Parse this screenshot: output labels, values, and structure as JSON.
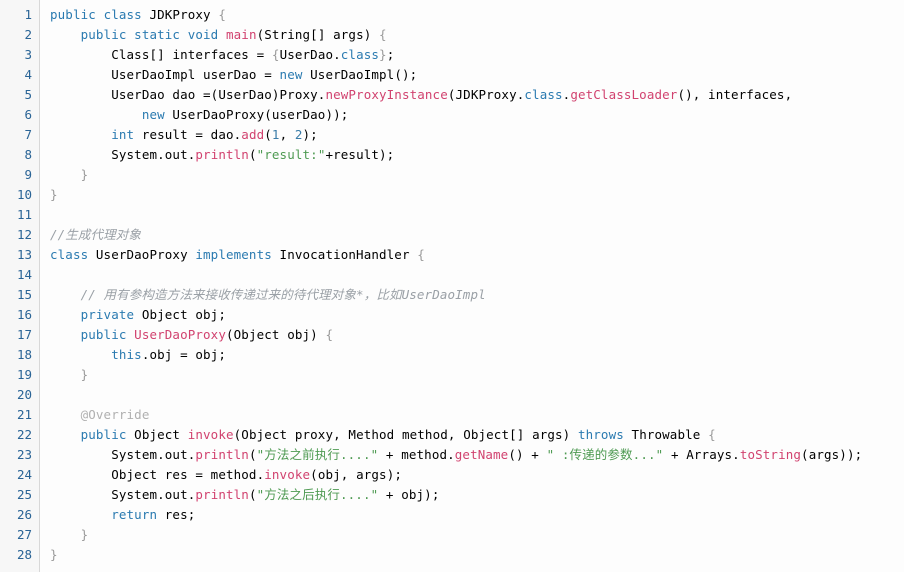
{
  "editor": {
    "language": "java",
    "first_line": 1,
    "total_lines": 28,
    "colors": {
      "background": "#fdfdfd",
      "gutter_background": "#f7f7f7",
      "gutter_border": "#d8d8d8",
      "line_number": "#2a6496",
      "keyword": "#2a7ab0",
      "identifier": "#000000",
      "method": "#d1426f",
      "string": "#4e9a52",
      "number": "#3a7ca8",
      "comment": "#9aa0a6",
      "annotation": "#b0b0b0",
      "brace": "#9a9a9a"
    }
  },
  "line_numbers": [
    "1",
    "2",
    "3",
    "4",
    "5",
    "6",
    "7",
    "8",
    "9",
    "10",
    "11",
    "12",
    "13",
    "14",
    "15",
    "16",
    "17",
    "18",
    "19",
    "20",
    "21",
    "22",
    "23",
    "24",
    "25",
    "26",
    "27",
    "28"
  ],
  "code_lines": [
    {
      "n": 1,
      "text": "public class JDKProxy {"
    },
    {
      "n": 2,
      "text": "    public static void main(String[] args) {"
    },
    {
      "n": 3,
      "text": "        Class[] interfaces = {UserDao.class};"
    },
    {
      "n": 4,
      "text": "        UserDaoImpl userDao = new UserDaoImpl();"
    },
    {
      "n": 5,
      "text": "        UserDao dao =(UserDao)Proxy.newProxyInstance(JDKProxy.class.getClassLoader(), interfaces,"
    },
    {
      "n": 6,
      "text": "            new UserDaoProxy(userDao));"
    },
    {
      "n": 7,
      "text": "        int result = dao.add(1, 2);"
    },
    {
      "n": 8,
      "text": "        System.out.println(\"result:\"+result);"
    },
    {
      "n": 9,
      "text": "    }"
    },
    {
      "n": 10,
      "text": "}"
    },
    {
      "n": 11,
      "text": ""
    },
    {
      "n": 12,
      "text": "//生成代理对象"
    },
    {
      "n": 13,
      "text": "class UserDaoProxy implements InvocationHandler {"
    },
    {
      "n": 14,
      "text": ""
    },
    {
      "n": 15,
      "text": "    // 用有参构造方法来接收传递过来的待代理对象*，比如UserDaoImpl"
    },
    {
      "n": 16,
      "text": "    private Object obj;"
    },
    {
      "n": 17,
      "text": "    public UserDaoProxy(Object obj) {"
    },
    {
      "n": 18,
      "text": "        this.obj = obj;"
    },
    {
      "n": 19,
      "text": "    }"
    },
    {
      "n": 20,
      "text": ""
    },
    {
      "n": 21,
      "text": "    @Override"
    },
    {
      "n": 22,
      "text": "    public Object invoke(Object proxy, Method method, Object[] args) throws Throwable {"
    },
    {
      "n": 23,
      "text": "        System.out.println(\"方法之前执行....\" + method.getName() + \" :传递的参数...\" + Arrays.toString(args));"
    },
    {
      "n": 24,
      "text": "        Object res = method.invoke(obj, args);"
    },
    {
      "n": 25,
      "text": "        System.out.println(\"方法之后执行....\" + obj);"
    },
    {
      "n": 26,
      "text": "        return res;"
    },
    {
      "n": 27,
      "text": "    }"
    },
    {
      "n": 28,
      "text": "}"
    }
  ],
  "tokens": {
    "l1": [
      [
        "public ",
        "t-kw"
      ],
      [
        "class ",
        "t-kw"
      ],
      [
        "JDKProxy ",
        "t-plain"
      ],
      [
        "{",
        "t-brc"
      ]
    ],
    "l2": [
      [
        "    ",
        "t-plain"
      ],
      [
        "public ",
        "t-kw"
      ],
      [
        "static ",
        "t-kw"
      ],
      [
        "void ",
        "t-kw"
      ],
      [
        "main",
        "t-meth"
      ],
      [
        "(",
        "t-punc"
      ],
      [
        "String",
        "t-plain"
      ],
      [
        "[] ",
        "t-punc"
      ],
      [
        "args",
        "t-plain"
      ],
      [
        ") ",
        "t-punc"
      ],
      [
        "{",
        "t-brc"
      ]
    ],
    "l3": [
      [
        "        ",
        "t-plain"
      ],
      [
        "Class",
        "t-plain"
      ],
      [
        "[] ",
        "t-punc"
      ],
      [
        "interfaces = ",
        "t-plain"
      ],
      [
        "{",
        "t-brc"
      ],
      [
        "UserDao",
        "t-plain"
      ],
      [
        ".",
        "t-punc"
      ],
      [
        "class",
        "t-kw"
      ],
      [
        "}",
        "t-brc"
      ],
      [
        ";",
        "t-punc"
      ]
    ],
    "l4": [
      [
        "        ",
        "t-plain"
      ],
      [
        "UserDaoImpl userDao = ",
        "t-plain"
      ],
      [
        "new ",
        "t-kw"
      ],
      [
        "UserDaoImpl",
        "t-plain"
      ],
      [
        "();",
        "t-punc"
      ]
    ],
    "l5": [
      [
        "        ",
        "t-plain"
      ],
      [
        "UserDao dao =(UserDao)Proxy",
        "t-plain"
      ],
      [
        ".",
        "t-punc"
      ],
      [
        "newProxyInstance",
        "t-meth"
      ],
      [
        "(",
        "t-punc"
      ],
      [
        "JDKProxy",
        "t-plain"
      ],
      [
        ".",
        "t-punc"
      ],
      [
        "class",
        "t-kw"
      ],
      [
        ".",
        "t-punc"
      ],
      [
        "getClassLoader",
        "t-meth"
      ],
      [
        "(), ",
        "t-punc"
      ],
      [
        "interfaces",
        "t-plain"
      ],
      [
        ",",
        "t-punc"
      ]
    ],
    "l6": [
      [
        "            ",
        "t-plain"
      ],
      [
        "new ",
        "t-kw"
      ],
      [
        "UserDaoProxy",
        "t-plain"
      ],
      [
        "(",
        "t-punc"
      ],
      [
        "userDao",
        "t-plain"
      ],
      [
        "));",
        "t-punc"
      ]
    ],
    "l7": [
      [
        "        ",
        "t-plain"
      ],
      [
        "int ",
        "t-kw"
      ],
      [
        "result = dao",
        "t-plain"
      ],
      [
        ".",
        "t-punc"
      ],
      [
        "add",
        "t-meth"
      ],
      [
        "(",
        "t-punc"
      ],
      [
        "1",
        "t-num"
      ],
      [
        ", ",
        "t-punc"
      ],
      [
        "2",
        "t-num"
      ],
      [
        ");",
        "t-punc"
      ]
    ],
    "l8": [
      [
        "        ",
        "t-plain"
      ],
      [
        "System",
        "t-plain"
      ],
      [
        ".",
        "t-punc"
      ],
      [
        "out",
        "t-plain"
      ],
      [
        ".",
        "t-punc"
      ],
      [
        "println",
        "t-meth"
      ],
      [
        "(",
        "t-punc"
      ],
      [
        "\"result:\"",
        "t-str"
      ],
      [
        "+",
        "t-punc"
      ],
      [
        "result",
        "t-plain"
      ],
      [
        ");",
        "t-punc"
      ]
    ],
    "l9": [
      [
        "    ",
        "t-plain"
      ],
      [
        "}",
        "t-brc"
      ]
    ],
    "l10": [
      [
        "}",
        "t-brc"
      ]
    ],
    "l11": [],
    "l12": [
      [
        "//生成代理对象",
        "t-cmt"
      ]
    ],
    "l13": [
      [
        "class ",
        "t-kw"
      ],
      [
        "UserDaoProxy ",
        "t-plain"
      ],
      [
        "implements ",
        "t-kw"
      ],
      [
        "InvocationHandler ",
        "t-plain"
      ],
      [
        "{",
        "t-brc"
      ]
    ],
    "l14": [],
    "l15": [
      [
        "    ",
        "t-plain"
      ],
      [
        "// 用有参构造方法来接收传递过来的待代理对象*，比如UserDaoImpl",
        "t-cmt"
      ]
    ],
    "l16": [
      [
        "    ",
        "t-plain"
      ],
      [
        "private ",
        "t-kw"
      ],
      [
        "Object obj",
        "t-plain"
      ],
      [
        ";",
        "t-punc"
      ]
    ],
    "l17": [
      [
        "    ",
        "t-plain"
      ],
      [
        "public ",
        "t-kw"
      ],
      [
        "UserDaoProxy",
        "t-meth"
      ],
      [
        "(",
        "t-punc"
      ],
      [
        "Object obj",
        "t-plain"
      ],
      [
        ") ",
        "t-punc"
      ],
      [
        "{",
        "t-brc"
      ]
    ],
    "l18": [
      [
        "        ",
        "t-plain"
      ],
      [
        "this",
        "t-kw"
      ],
      [
        ".",
        "t-punc"
      ],
      [
        "obj = obj",
        "t-plain"
      ],
      [
        ";",
        "t-punc"
      ]
    ],
    "l19": [
      [
        "    ",
        "t-plain"
      ],
      [
        "}",
        "t-brc"
      ]
    ],
    "l20": [],
    "l21": [
      [
        "    ",
        "t-plain"
      ],
      [
        "@Override",
        "t-ann"
      ]
    ],
    "l22": [
      [
        "    ",
        "t-plain"
      ],
      [
        "public ",
        "t-kw"
      ],
      [
        "Object ",
        "t-plain"
      ],
      [
        "invoke",
        "t-meth"
      ],
      [
        "(",
        "t-punc"
      ],
      [
        "Object proxy",
        "t-plain"
      ],
      [
        ", ",
        "t-punc"
      ],
      [
        "Method method",
        "t-plain"
      ],
      [
        ", ",
        "t-punc"
      ],
      [
        "Object",
        "t-plain"
      ],
      [
        "[] ",
        "t-punc"
      ],
      [
        "args",
        "t-plain"
      ],
      [
        ") ",
        "t-punc"
      ],
      [
        "throws ",
        "t-kw"
      ],
      [
        "Throwable ",
        "t-plain"
      ],
      [
        "{",
        "t-brc"
      ]
    ],
    "l23": [
      [
        "        ",
        "t-plain"
      ],
      [
        "System",
        "t-plain"
      ],
      [
        ".",
        "t-punc"
      ],
      [
        "out",
        "t-plain"
      ],
      [
        ".",
        "t-punc"
      ],
      [
        "println",
        "t-meth"
      ],
      [
        "(",
        "t-punc"
      ],
      [
        "\"方法之前执行....\"",
        "t-str"
      ],
      [
        " + ",
        "t-punc"
      ],
      [
        "method",
        "t-plain"
      ],
      [
        ".",
        "t-punc"
      ],
      [
        "getName",
        "t-meth"
      ],
      [
        "() + ",
        "t-punc"
      ],
      [
        "\" :传递的参数...\"",
        "t-str"
      ],
      [
        " + ",
        "t-punc"
      ],
      [
        "Arrays",
        "t-plain"
      ],
      [
        ".",
        "t-punc"
      ],
      [
        "toString",
        "t-meth"
      ],
      [
        "(",
        "t-punc"
      ],
      [
        "args",
        "t-plain"
      ],
      [
        "));",
        "t-punc"
      ]
    ],
    "l24": [
      [
        "        ",
        "t-plain"
      ],
      [
        "Object res = method",
        "t-plain"
      ],
      [
        ".",
        "t-punc"
      ],
      [
        "invoke",
        "t-meth"
      ],
      [
        "(",
        "t-punc"
      ],
      [
        "obj",
        "t-plain"
      ],
      [
        ", ",
        "t-punc"
      ],
      [
        "args",
        "t-plain"
      ],
      [
        ");",
        "t-punc"
      ]
    ],
    "l25": [
      [
        "        ",
        "t-plain"
      ],
      [
        "System",
        "t-plain"
      ],
      [
        ".",
        "t-punc"
      ],
      [
        "out",
        "t-plain"
      ],
      [
        ".",
        "t-punc"
      ],
      [
        "println",
        "t-meth"
      ],
      [
        "(",
        "t-punc"
      ],
      [
        "\"方法之后执行....\"",
        "t-str"
      ],
      [
        " + ",
        "t-punc"
      ],
      [
        "obj",
        "t-plain"
      ],
      [
        ");",
        "t-punc"
      ]
    ],
    "l26": [
      [
        "        ",
        "t-plain"
      ],
      [
        "return ",
        "t-kw"
      ],
      [
        "res",
        "t-plain"
      ],
      [
        ";",
        "t-punc"
      ]
    ],
    "l27": [
      [
        "    ",
        "t-plain"
      ],
      [
        "}",
        "t-brc"
      ]
    ],
    "l28": [
      [
        "}",
        "t-brc"
      ]
    ]
  }
}
